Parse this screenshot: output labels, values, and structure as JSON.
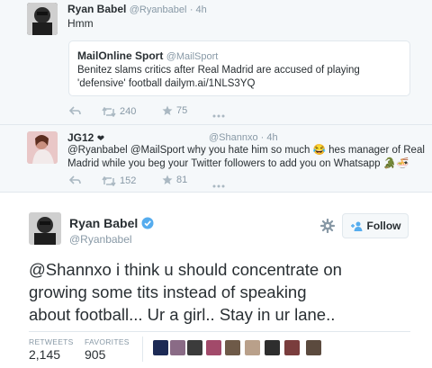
{
  "tweet1": {
    "name": "Ryan Babel",
    "handle": "@Ryanbabel",
    "time": "· 4h",
    "text": "Hmm",
    "quote": {
      "name": "MailOnline Sport",
      "handle": "@MailSport",
      "text": "Benitez slams critics after Real Madrid are accused of playing 'defensive' football dailym.ai/1NLS3YQ"
    },
    "retweets": "240",
    "favorites": "75"
  },
  "reply": {
    "name": "JG12",
    "name_badge": "❤",
    "handle": "@Shannxo",
    "time": "· 4h",
    "text_line1": "@Ryanbabel @MailSport why you hate him so much 😂 hes manager of Real",
    "text_line2": "Madrid while you beg your Twitter followers to add you on Whatsapp 🐊🍜",
    "retweets": "152",
    "favorites": "81"
  },
  "main_tweet": {
    "name": "Ryan Babel",
    "handle": "@Ryanbabel",
    "follow_label": "Follow",
    "text_line1": "@Shannxo i think u should concentrate on",
    "text_line2": "growing some tits instead of speaking",
    "text_line3": "about football... Ur a girl.. Stay in ur lane..",
    "retweets_label": "RETWEETS",
    "retweets_count": "2,145",
    "favorites_label": "FAVORITES",
    "favorites_count": "905"
  },
  "colors": {
    "blue": "#55acee",
    "verified": "#55acee",
    "muted": "#8899a6",
    "icon": "#aab8c2",
    "border": "#e1e8ed"
  },
  "icons": [
    "reply-icon",
    "retweet-icon",
    "favorite-icon",
    "more-icon",
    "verified-icon",
    "gear-icon",
    "follow-icon"
  ]
}
